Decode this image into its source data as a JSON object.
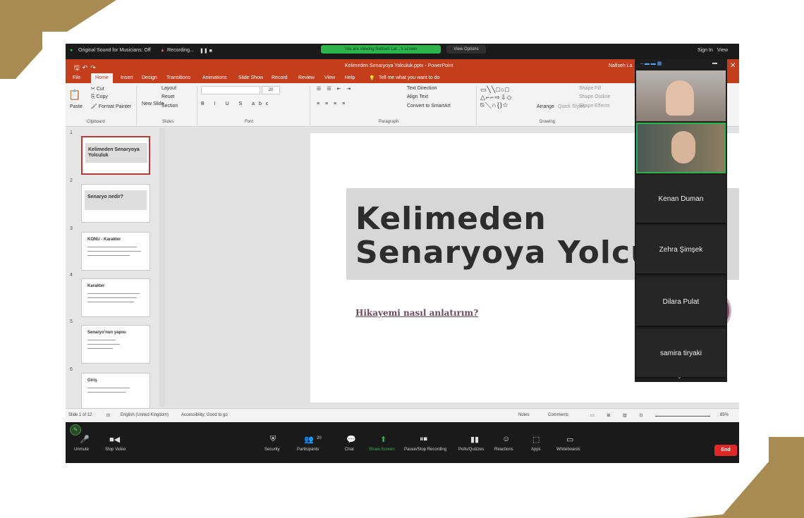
{
  "colors": {
    "ppt_accent": "#c43e1c",
    "zoom_green": "#2eb24b",
    "end_red": "#e02828",
    "gold_deco": "#a88b52"
  },
  "zoom_top": {
    "sound": "Original Sound for Musicians: Off",
    "recording": "Recording...",
    "share_banner": "You are viewing Nafiseh Lat...'s screen",
    "view_options": "View Options",
    "sign_in": "Sign In",
    "view": "View"
  },
  "ppt": {
    "doc_title": "Kelimeden Senaryoya Yolculuk.pptx - PowerPoint",
    "user": "Nafiseh La",
    "tabs": [
      "File",
      "Home",
      "Insert",
      "Design",
      "Transitions",
      "Animations",
      "Slide Show",
      "Record",
      "Review",
      "View",
      "Help"
    ],
    "tell_me": "Tell me what you want to do",
    "ribbon": {
      "cut": "Cut",
      "copy": "Copy",
      "paste": "Paste",
      "format_painter": "Format Painter",
      "clipboard": "Clipboard",
      "new_slide": "New Slide",
      "layout": "Layout",
      "reset": "Reset",
      "section": "Section",
      "slides": "Slides",
      "font_size": "20",
      "font": "Font",
      "text_direction": "Text Direction",
      "align_text": "Align Text",
      "convert_smartart": "Convert to SmartArt",
      "paragraph": "Paragraph",
      "arrange": "Arrange",
      "quick_styles": "Quick Styles",
      "shape_fill": "Shape Fill",
      "shape_outline": "Shape Outline",
      "shape_effects": "Shape Effects",
      "drawing": "Drawing"
    },
    "thumbnails": [
      {
        "num": "1",
        "title": "Kelimeden Senaryoya Yolculuk"
      },
      {
        "num": "2",
        "title": "Senaryo nedir?"
      },
      {
        "num": "3",
        "title": "KONU - Karakter"
      },
      {
        "num": "4",
        "title": "Karakter"
      },
      {
        "num": "5",
        "title": "Senaryo'nun yapısı"
      },
      {
        "num": "6",
        "title": "Giriş"
      }
    ],
    "slide": {
      "title_line1": "Kelimeden",
      "title_line2": "Senaryoya Yolculuk",
      "subtitle": "Hikayemi nasıl anlatırım?"
    },
    "status": {
      "slide_count": "Slide 1 of 12",
      "language": "English (United Kingdom)",
      "accessibility": "Accessibility: Good to go",
      "notes": "Notes",
      "comments": "Comments",
      "zoom": "85%"
    }
  },
  "participants": [
    {
      "name": "Kenan Duman"
    },
    {
      "name": "Zehra Şimşek"
    },
    {
      "name": "Dilara Pulat"
    },
    {
      "name": "samira tiryaki"
    }
  ],
  "controls": {
    "unmute": "Unmute",
    "stop_video": "Stop Video",
    "security": "Security",
    "participants": "Participants",
    "participants_count": "20",
    "chat": "Chat",
    "share_screen": "Share Screen",
    "pause_recording": "Pause/Stop Recording",
    "polls": "Polls/Quizzes",
    "reactions": "Reactions",
    "apps": "Apps",
    "whiteboards": "Whiteboards",
    "end": "End"
  }
}
